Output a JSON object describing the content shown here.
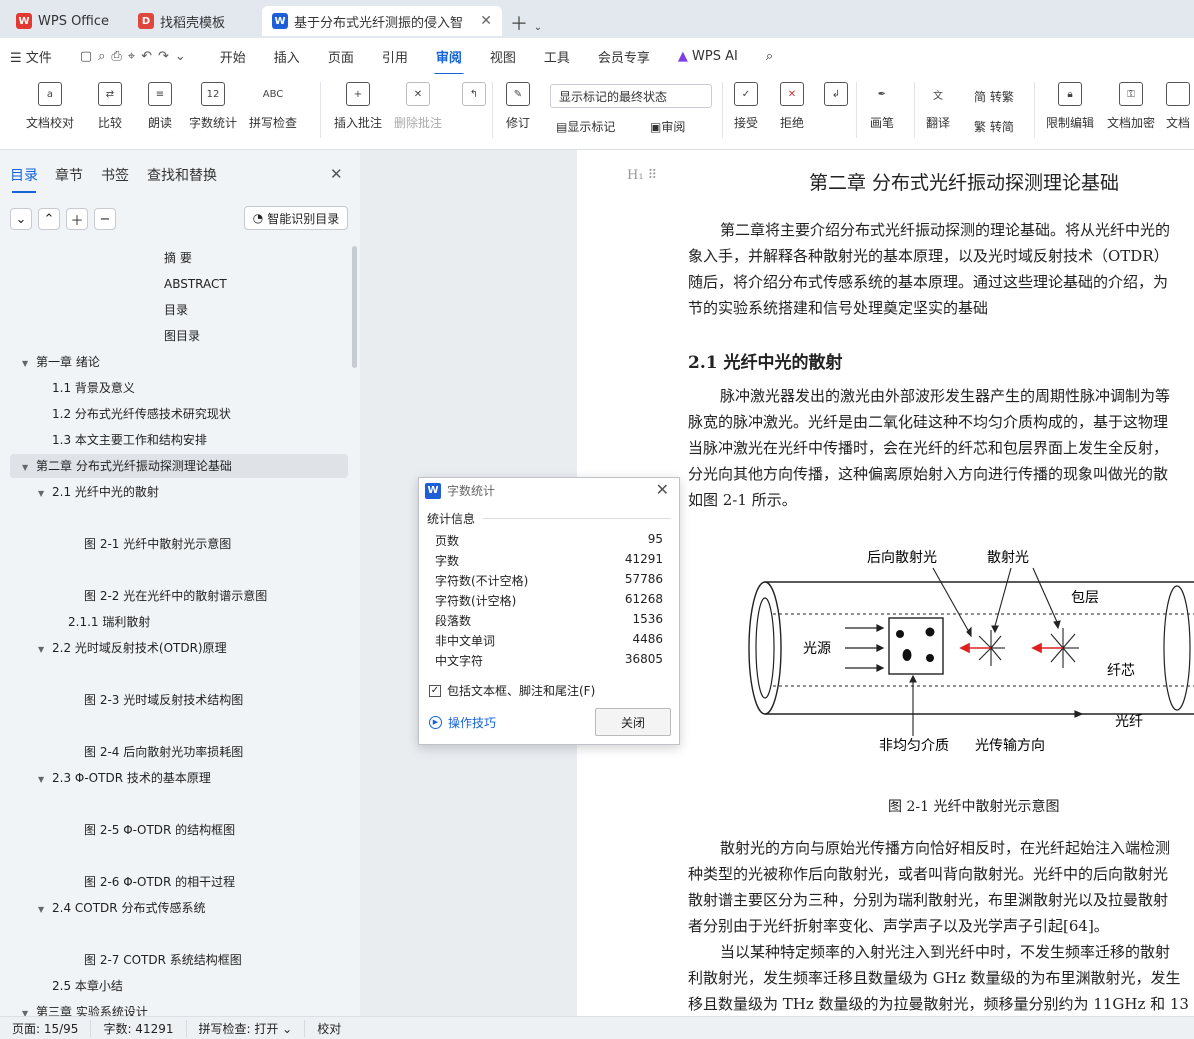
{
  "tabs": {
    "wps": "WPS Office",
    "template": "找稻壳模板",
    "doc": "基于分布式光纤测振的侵入智能"
  },
  "menu": {
    "file": "文件",
    "items": [
      "开始",
      "插入",
      "页面",
      "引用",
      "审阅",
      "视图",
      "工具",
      "会员专享"
    ],
    "ai": "WPS AI"
  },
  "ribbon": {
    "proof": "文档校对",
    "compare": "比较",
    "read": "朗读",
    "wordcount": "字数统计",
    "spell": "拼写检查",
    "addcomment": "插入批注",
    "delcomment": "删除批注",
    "revise": "修订",
    "markup_select": "显示标记的最终状态",
    "showmarkup": "显示标记",
    "review": "审阅",
    "accept": "接受",
    "reject": "拒绝",
    "pen": "画笔",
    "translate": "翻译",
    "trad": "简 转繁",
    "simp": "繁 转简",
    "restrict": "限制编辑",
    "encrypt": "文档加密",
    "cut": "文档"
  },
  "sidebar": {
    "tabs": [
      "目录",
      "章节",
      "书签",
      "查找和替换"
    ],
    "ai_toc": "智能识别目录",
    "toc": [
      "摘  要",
      "ABSTRACT",
      "目录",
      "图目录",
      "第一章  绪论",
      "1.1  背景及意义",
      "1.2  分布式光纤传感技术研究现状",
      "1.3  本文主要工作和结构安排",
      "第二章  分布式光纤振动探测理论基础",
      "2.1  光纤中光的散射",
      "图 2-1  光纤中散射光示意图",
      "图 2-2  光在光纤中的散射谱示意图",
      "2.1.1  瑞利散射",
      "2.2  光时域反射技术(OTDR)原理",
      "图 2-3  光时域反射技术结构图",
      "图 2-4  后向散射光功率损耗图",
      "2.3 Φ-OTDR 技术的基本原理",
      "图 2-5 Φ-OTDR 的结构框图",
      "图 2-6 Φ-OTDR 的相干过程",
      "2.4 COTDR 分布式传感系统",
      "图 2-7 COTDR 系统结构框图",
      "2.5  本章小结",
      "第三章  实验系统设计"
    ]
  },
  "doc": {
    "h1": "第二章  分布式光纤振动探测理论基础",
    "p1": [
      "第二章将主要介绍分布式光纤振动探测的理论基础。将从光纤中光的",
      "象入手，并解释各种散射光的基本原理，以及光时域反射技术（OTDR）",
      "随后，将介绍分布式传感系统的基本原理。通过这些理论基础的介绍，为",
      "节的实验系统搭建和信号处理奠定坚实的基础"
    ],
    "h2": "2.1  光纤中光的散射",
    "p2": [
      "脉冲激光器发出的激光由外部波形发生器产生的周期性脉冲调制为等",
      "脉宽的脉冲激光。光纤是由二氧化硅这种不均匀介质构成的，基于这物理",
      "当脉冲激光在光纤中传播时，会在光纤的纤芯和包层界面上发生全反射，",
      "分光向其他方向传播，这种偏离原始射入方向进行传播的现象叫做光的散",
      "如图 2-1 所示。"
    ],
    "fig": {
      "back": "后向散射光",
      "scatter": "散射光",
      "cladding": "包层",
      "source": "光源",
      "core": "纤芯",
      "fiber": "光纤",
      "medium": "非均匀介质",
      "dir": "光传输方向"
    },
    "caption": "图 2-1  光纤中散射光示意图",
    "p3": [
      "散射光的方向与原始光传播方向恰好相反时，在光纤起始注入端检测",
      "种类型的光被称作后向散射光，或者叫背向散射光。光纤中的后向散射光",
      "散射谱主要区分为三种，分别为瑞利散射光，布里渊散射光以及拉曼散射",
      "者分别由于光纤折射率变化、声学声子以及光学声子引起[64]。",
      "当以某种特定频率的入射光注入到光纤中时，不发生频率迁移的散射",
      "利散射光，发生频率迁移且数量级为 GHz 数量级的为布里渊散射光，发生",
      "移且数量级为 THz 数量级的为拉曼散射光，频移量分别约为 11GHz 和 13"
    ]
  },
  "dialog": {
    "title": "字数统计",
    "section": "统计信息",
    "rows": [
      [
        "页数",
        "95"
      ],
      [
        "字数",
        "41291"
      ],
      [
        "字符数(不计空格)",
        "57786"
      ],
      [
        "字符数(计空格)",
        "61268"
      ],
      [
        "段落数",
        "1536"
      ],
      [
        "非中文单词",
        "4486"
      ],
      [
        "中文字符",
        "36805"
      ]
    ],
    "include": "包括文本框、脚注和尾注(F)",
    "tips": "操作技巧",
    "close": "关闭"
  },
  "status": {
    "page": "页面: 15/95",
    "words": "字数: 41291",
    "spell": "拼写检查: 打开 ⌄",
    "proof": "校对"
  }
}
